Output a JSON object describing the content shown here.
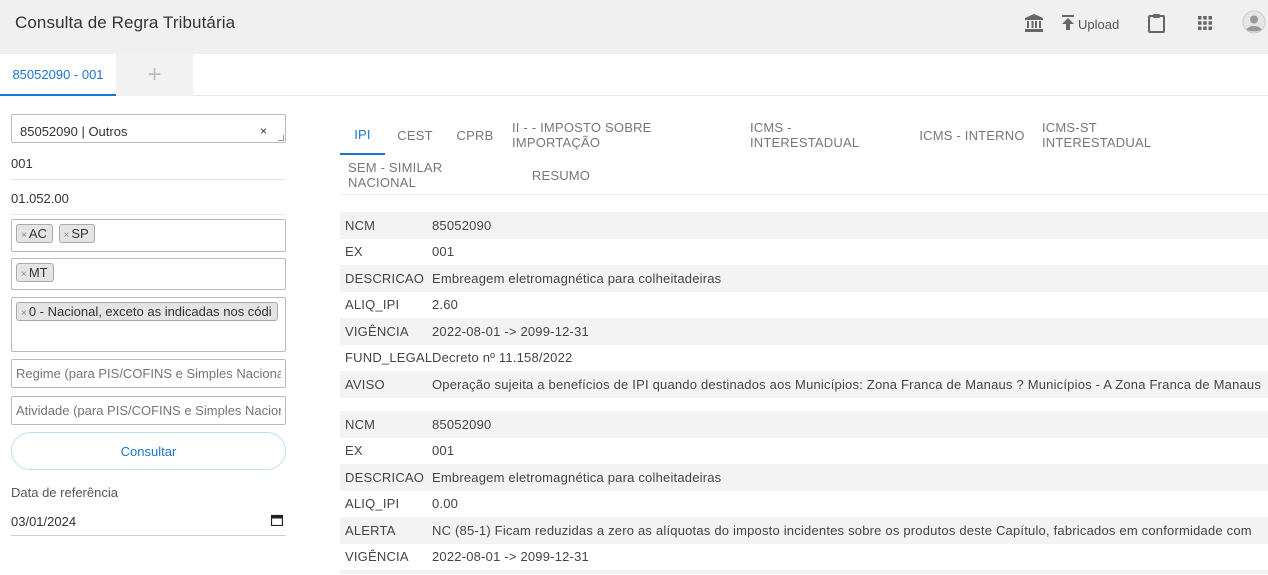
{
  "header": {
    "title": "Consulta de Regra Tributária",
    "upload_label": "Upload",
    "icons": [
      "bank-icon",
      "upload-icon",
      "clipboard-icon",
      "apps-grid-icon",
      "user-avatar-icon"
    ]
  },
  "tabs": {
    "active_label": "85052090 - 001",
    "add_label": "+"
  },
  "form": {
    "ncm_value": "85052090 | Outros",
    "clear_label": "×",
    "ex_value": "001",
    "cest_value": "01.052.00",
    "uf_origin_tags": [
      "AC",
      "SP"
    ],
    "uf_dest_tags": [
      "MT"
    ],
    "origin_tags": [
      "0 - Nacional, exceto as indicadas nos códi"
    ],
    "tag_remove": "×",
    "regime_placeholder": "Regime (para PIS/COFINS e Simples Nacional)",
    "atividade_placeholder": "Atividade (para PIS/COFINS e Simples Nacional)",
    "consultar_label": "Consultar",
    "date_label": "Data de referência",
    "date_value": "03/01/2024"
  },
  "tax_tabs": [
    "IPI",
    "CEST",
    "CPRB",
    "II - - IMPOSTO SOBRE IMPORTAÇÃO",
    "ICMS - INTERESTADUAL",
    "ICMS - INTERNO",
    "ICMS-ST INTERESTADUAL",
    "SEM - SIMILAR NACIONAL",
    "RESUMO"
  ],
  "active_tax_tab": "IPI",
  "colors": {
    "accent": "#1976d2",
    "header_bg": "#f0f0f0",
    "row_stripe": "#f3f3f3"
  },
  "tables": [
    {
      "rows": [
        {
          "key": "NCM",
          "value": "85052090"
        },
        {
          "key": "EX",
          "value": "001"
        },
        {
          "key": "DESCRICAO",
          "value": "Embreagem eletromagnética para colheitadeiras"
        },
        {
          "key": "ALIQ_IPI",
          "value": "2.60"
        },
        {
          "key": "VIGÊNCIA",
          "value": "2022-08-01 -> 2099-12-31"
        },
        {
          "key": "FUND_LEGAL",
          "value": "Decreto nº 11.158/2022"
        },
        {
          "key": "AVISO",
          "value": "Operação sujeita a benefícios de IPI quando destinados aos Municípios: Zona Franca de Manaus ? Municípios - A Zona Franca de Manaus"
        }
      ]
    },
    {
      "rows": [
        {
          "key": "NCM",
          "value": "85052090"
        },
        {
          "key": "EX",
          "value": "001"
        },
        {
          "key": "DESCRICAO",
          "value": "Embreagem eletromagnética para colheitadeiras"
        },
        {
          "key": "ALIQ_IPI",
          "value": "0.00"
        },
        {
          "key": "ALERTA",
          "value": "NC (85-1) Ficam reduzidas a zero as alíquotas do imposto incidentes sobre os produtos deste Capítulo, fabricados em conformidade com"
        },
        {
          "key": "VIGÊNCIA",
          "value": "2022-08-01 -> 2099-12-31"
        }
      ]
    }
  ]
}
